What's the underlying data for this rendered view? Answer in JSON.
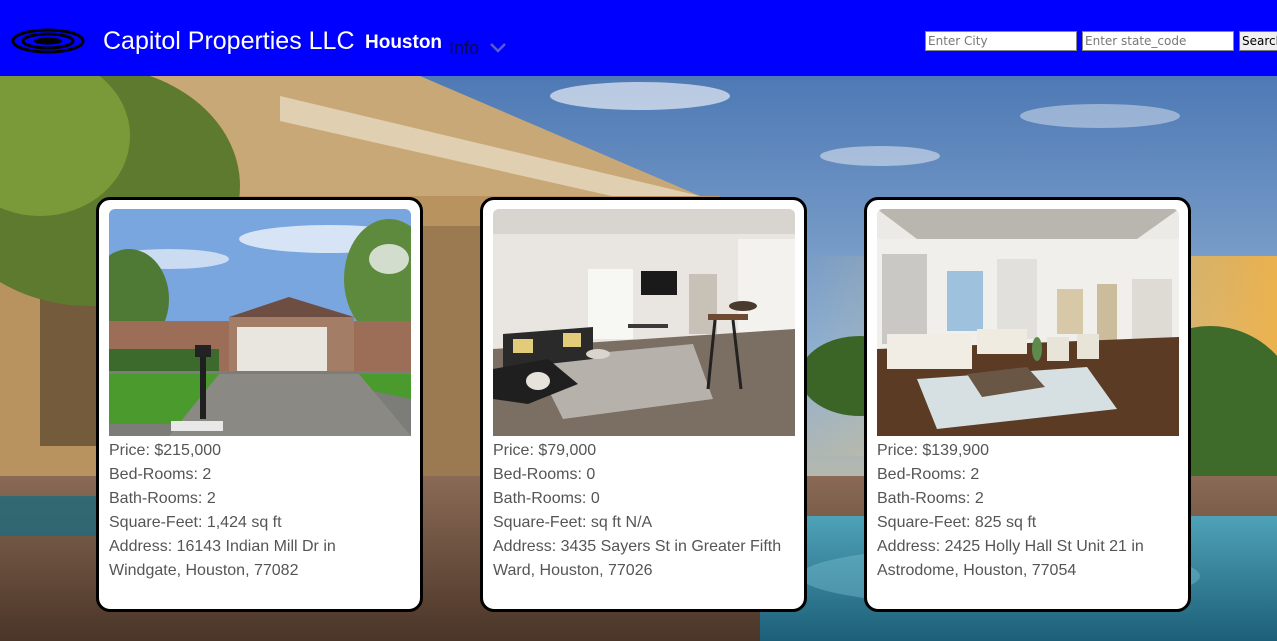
{
  "header": {
    "brand": "Capitol Properties LLC",
    "city": "Houston",
    "info_label": "Info",
    "city_placeholder": "Enter City",
    "state_placeholder": "Enter state_code",
    "search_label": "Search",
    "colors": {
      "header_bg": "#0000ff"
    }
  },
  "listings": [
    {
      "price": "Price: $215,000",
      "bedrooms": "Bed-Rooms: 2",
      "bathrooms": "Bath-Rooms: 2",
      "sqft": "Square-Feet: 1,424 sq ft",
      "address": "Address: 16143 Indian Mill Dr in Windgate, Houston, 77082",
      "photo": "house-exterior-garage"
    },
    {
      "price": "Price: $79,000",
      "bedrooms": "Bed-Rooms: 0",
      "bathrooms": "Bath-Rooms: 0",
      "sqft": "Square-Feet: sq ft N/A",
      "address": "Address: 3435 Sayers St in Greater Fifth Ward, Houston, 77026",
      "photo": "living-room-interior"
    },
    {
      "price": "Price: $139,900",
      "bedrooms": "Bed-Rooms: 2",
      "bathrooms": "Bath-Rooms: 2",
      "sqft": "Square-Feet: 825 sq ft",
      "address": "Address: 2425 Holly Hall St Unit 21 in Astrodome, Houston, 77054",
      "photo": "open-living-room-interior"
    }
  ]
}
